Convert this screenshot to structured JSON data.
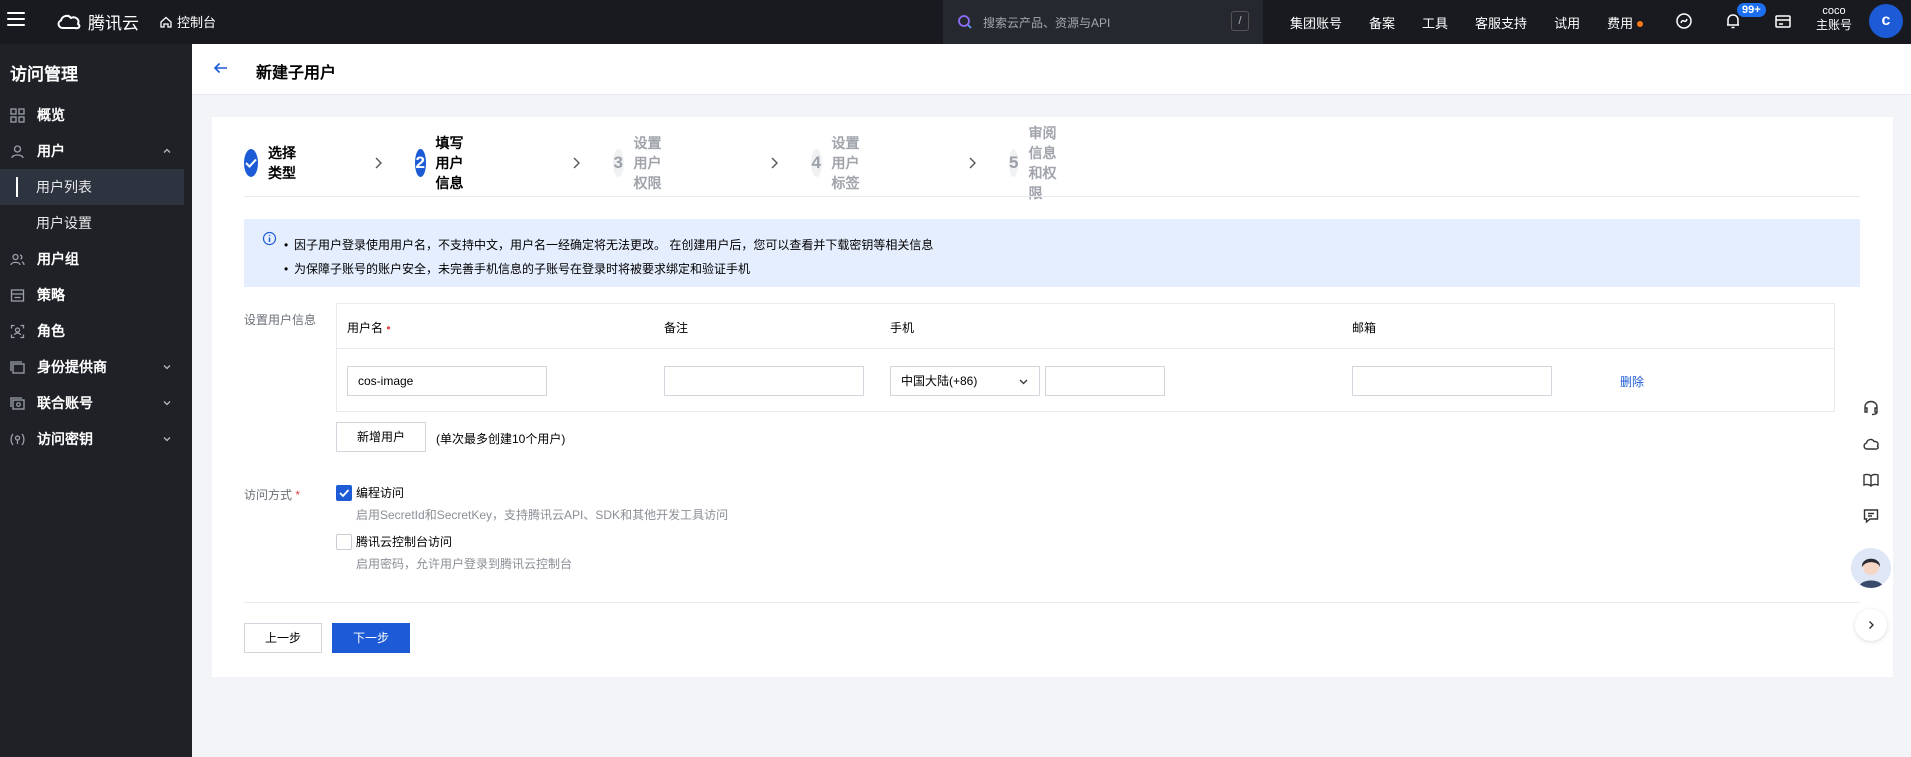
{
  "topbar": {
    "brand": "腾讯云",
    "console": "控制台",
    "search_placeholder": "搜索云产品、资源与API",
    "search_shortcut": "/",
    "nav": [
      "集团账号",
      "备案",
      "工具",
      "客服支持",
      "试用",
      "费用"
    ],
    "notification_count": "99+",
    "account_name": "coco",
    "account_role": "主账号",
    "avatar_letter": "c"
  },
  "sidebar": {
    "title": "访问管理",
    "items": [
      {
        "label": "概览",
        "icon": "grid-icon"
      },
      {
        "label": "用户",
        "icon": "user-icon",
        "expanded": true
      },
      {
        "label": "用户列表",
        "sub": true,
        "active": true
      },
      {
        "label": "用户设置",
        "sub": true
      },
      {
        "label": "用户组",
        "icon": "user-group-icon"
      },
      {
        "label": "策略",
        "icon": "policy-icon"
      },
      {
        "label": "角色",
        "icon": "role-icon"
      },
      {
        "label": "身份提供商",
        "icon": "idp-icon",
        "collapsible": true
      },
      {
        "label": "联合账号",
        "icon": "federation-icon",
        "collapsible": true
      },
      {
        "label": "访问密钥",
        "icon": "key-icon",
        "collapsible": true
      }
    ]
  },
  "header": {
    "title": "新建子用户"
  },
  "steps": [
    {
      "num": "1",
      "label": "选择类型",
      "state": "done"
    },
    {
      "num": "2",
      "label": "填写用户信息",
      "state": "current"
    },
    {
      "num": "3",
      "label": "设置用户权限",
      "state": "todo"
    },
    {
      "num": "4",
      "label": "设置用户标签",
      "state": "todo"
    },
    {
      "num": "5",
      "label": "审阅信息和权限",
      "state": "todo"
    }
  ],
  "info": {
    "line1": "因子用户登录使用用户名，不支持中文，用户名一经确定将无法更改。 在创建用户后，您可以查看并下载密钥等相关信息",
    "line2": "为保障子账号的账户安全，未完善手机信息的子账号在登录时将被要求绑定和验证手机"
  },
  "form": {
    "user_info_label": "设置用户信息",
    "columns": {
      "username": "用户名",
      "remark": "备注",
      "phone": "手机",
      "email": "邮箱"
    },
    "row": {
      "username": "cos-image",
      "remark": "",
      "phone_region": "中国大陆(+86)",
      "phone": "",
      "email": "",
      "delete": "删除"
    },
    "add_user": "新增用户",
    "add_hint": "(单次最多创建10个用户)",
    "access_label": "访问方式",
    "access": [
      {
        "label": "编程访问",
        "desc": "启用SecretId和SecretKey，支持腾讯云API、SDK和其他开发工具访问",
        "checked": true
      },
      {
        "label": "腾讯云控制台访问",
        "desc": "启用密码，允许用户登录到腾讯云控制台",
        "checked": false
      }
    ],
    "prev": "上一步",
    "next": "下一步"
  },
  "colors": {
    "primary": "#1d5bd6",
    "topbar_bg": "#181a1f",
    "sidebar_bg": "#1f2126",
    "info_bg": "#e5eefe"
  }
}
